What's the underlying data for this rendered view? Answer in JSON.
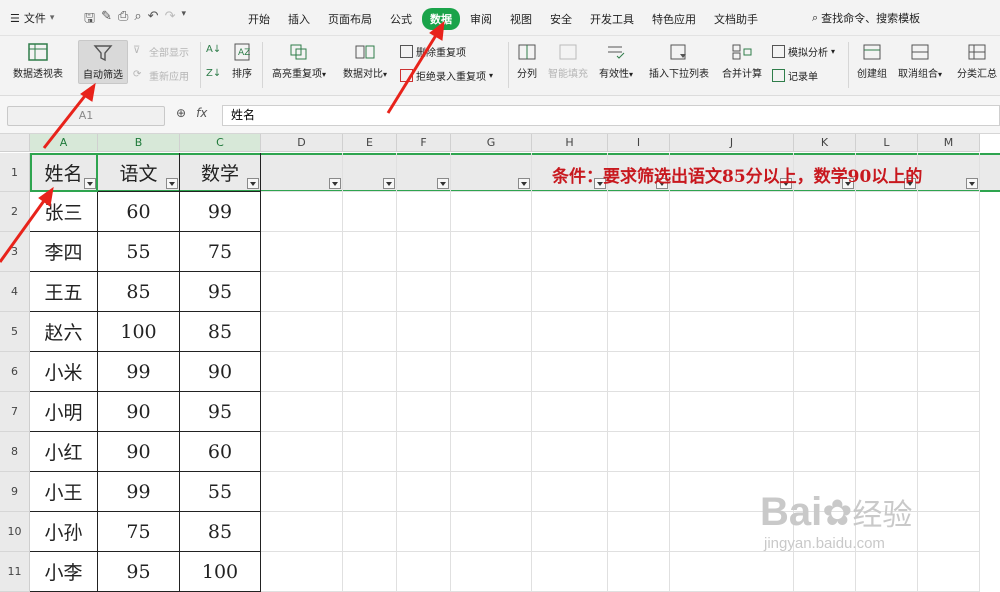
{
  "menubar": {
    "file_label": "文件",
    "tabs": [
      "开始",
      "插入",
      "页面布局",
      "公式",
      "数据",
      "审阅",
      "视图",
      "安全",
      "开发工具",
      "特色应用",
      "文档助手"
    ],
    "active_tab": "数据",
    "search_label": "查找命令、搜索模板"
  },
  "ribbon": {
    "pivot": "数据透视表",
    "autofilter": "自动筛选",
    "show_all": "全部显示",
    "reapply": "重新应用",
    "sort": "排序",
    "highlight_dup": "高亮重复项",
    "compare": "数据对比",
    "remove_dup": "删除重复项",
    "reject_dup": "拒绝录入重复项",
    "split": "分列",
    "smart_fill": "智能填充",
    "validity": "有效性",
    "dropdown": "插入下拉列表",
    "consolidate": "合并计算",
    "simulate": "模拟分析",
    "record": "记录单",
    "group": "创建组",
    "ungroup": "取消组合",
    "subtotal": "分类汇总"
  },
  "formula_bar": {
    "name_box": "A1",
    "fx": "fx",
    "value": "姓名"
  },
  "grid": {
    "columns": [
      "A",
      "B",
      "C",
      "D",
      "E",
      "F",
      "G",
      "H",
      "I",
      "J",
      "K",
      "L",
      "M"
    ],
    "rows": [
      "1",
      "2",
      "3",
      "4",
      "5",
      "6",
      "7",
      "8",
      "9",
      "10",
      "11"
    ],
    "headers": [
      "姓名",
      "语文",
      "数学"
    ],
    "data": [
      [
        "张三",
        "60",
        "99"
      ],
      [
        "李四",
        "55",
        "75"
      ],
      [
        "王五",
        "85",
        "95"
      ],
      [
        "赵六",
        "100",
        "85"
      ],
      [
        "小米",
        "99",
        "90"
      ],
      [
        "小明",
        "90",
        "95"
      ],
      [
        "小红",
        "90",
        "60"
      ],
      [
        "小王",
        "99",
        "55"
      ],
      [
        "小孙",
        "75",
        "85"
      ],
      [
        "小李",
        "95",
        "100"
      ]
    ],
    "condition_note": "条件：要求筛选出语文85分以上，数学90以上的"
  },
  "watermark": {
    "brand": "Bai",
    "brand_cn": "经验",
    "url": "jingyan.baidu.com"
  },
  "colors": {
    "active_tab": "#1aa34a",
    "annotation_red": "#c8181e",
    "selection_green": "#2ea44f"
  }
}
